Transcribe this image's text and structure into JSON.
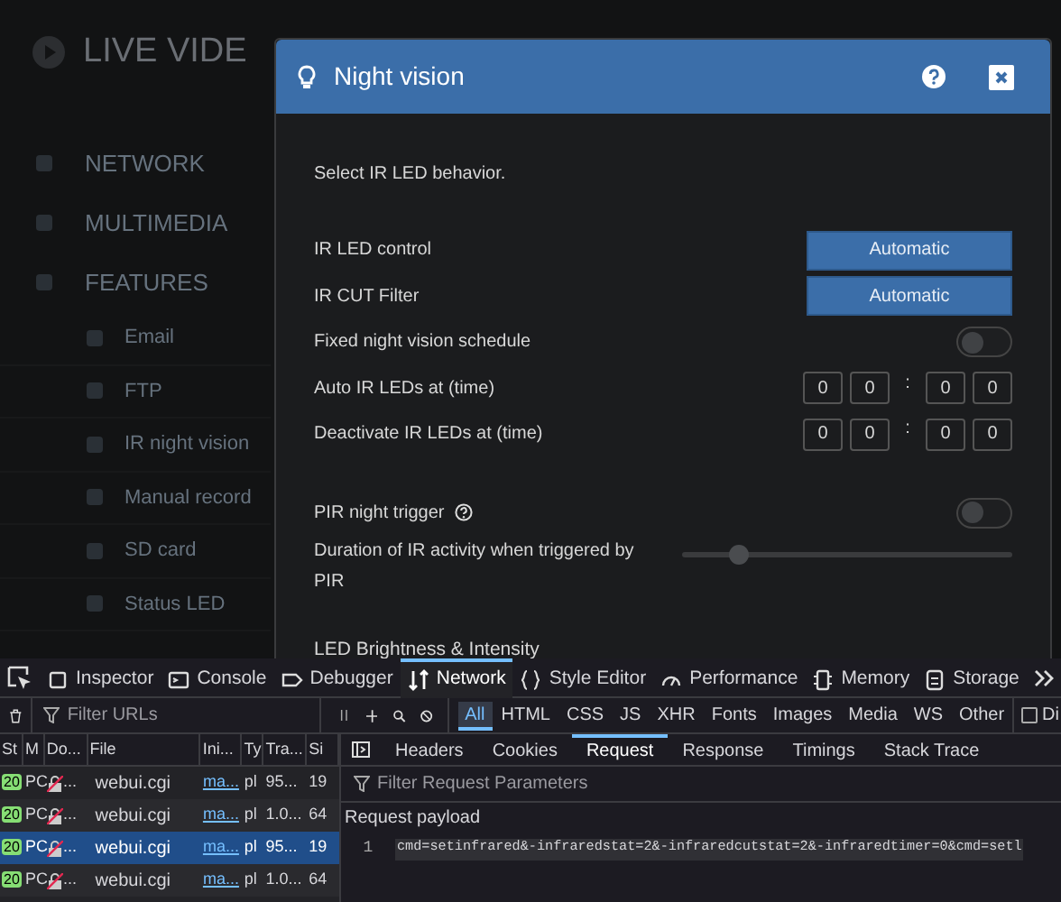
{
  "sidebar": {
    "logo": "LIVE VIDE",
    "items": [
      {
        "label": "NETWORK",
        "kind": "section"
      },
      {
        "label": "MULTIMEDIA",
        "kind": "section"
      },
      {
        "label": "FEATURES",
        "kind": "section"
      },
      {
        "label": "Email",
        "kind": "sub"
      },
      {
        "label": "FTP",
        "kind": "sub"
      },
      {
        "label": "IR night vision",
        "kind": "sub"
      },
      {
        "label": "Manual record",
        "kind": "sub"
      },
      {
        "label": "SD card",
        "kind": "sub"
      },
      {
        "label": "Status LED",
        "kind": "sub"
      }
    ]
  },
  "dialog": {
    "title": "Night vision",
    "intro": "Select IR LED behavior.",
    "groups": [
      [
        {
          "kind": "select",
          "label": "IR LED control",
          "value": "Automatic"
        },
        {
          "kind": "select",
          "label": "IR CUT Filter",
          "value": "Automatic"
        },
        {
          "kind": "toggle",
          "label": "Fixed night vision schedule",
          "on": false,
          "help": false
        },
        {
          "kind": "time",
          "label": "Auto IR LEDs at (time)",
          "digits": [
            "0",
            "0",
            "0",
            "0"
          ],
          "separator": ":"
        },
        {
          "kind": "time",
          "label": "Deactivate IR LEDs at (time)",
          "digits": [
            "0",
            "0",
            "0",
            "0"
          ],
          "separator": ":"
        }
      ],
      [
        {
          "kind": "toggle",
          "label": "PIR night trigger",
          "on": false,
          "help": true
        },
        {
          "kind": "slider",
          "label": "Duration of IR activity when triggered by PIR",
          "level": 0.17
        }
      ]
    ],
    "section_title": "LED Brightness & Intensity"
  },
  "devtools": {
    "tabs": [
      {
        "label": "Inspector",
        "selected": false
      },
      {
        "label": "Console",
        "selected": false
      },
      {
        "label": "Debugger",
        "selected": false
      },
      {
        "label": "Network",
        "selected": true
      },
      {
        "label": "Style Editor",
        "selected": false
      },
      {
        "label": "Performance",
        "selected": false
      },
      {
        "label": "Memory",
        "selected": false
      },
      {
        "label": "Storage",
        "selected": false
      }
    ],
    "filter": {
      "placeholder": "Filter URLs"
    },
    "type_filters": [
      {
        "label": "All",
        "selected": true
      },
      {
        "label": "HTML",
        "selected": false
      },
      {
        "label": "CSS",
        "selected": false
      },
      {
        "label": "JS",
        "selected": false
      },
      {
        "label": "XHR",
        "selected": false
      },
      {
        "label": "Fonts",
        "selected": false
      },
      {
        "label": "Images",
        "selected": false
      },
      {
        "label": "Media",
        "selected": false
      },
      {
        "label": "WS",
        "selected": false
      },
      {
        "label": "Other",
        "selected": false
      }
    ],
    "disable_cache": {
      "label": "Di",
      "checked": false
    },
    "table": {
      "columns": [
        "St",
        "M",
        "Do...",
        "File",
        "Ini...",
        "Ty",
        "Tra...",
        "Si"
      ],
      "rows": [
        {
          "status": "20",
          "method": "PC",
          "domain": "...",
          "file": "webui.cgi",
          "initiator": "ma...",
          "type": "pl",
          "transferred": "95...",
          "size": "19",
          "selected": false
        },
        {
          "status": "20",
          "method": "PC",
          "domain": "...",
          "file": "webui.cgi",
          "initiator": "ma...",
          "type": "pl",
          "transferred": "1.0...",
          "size": "64",
          "selected": false
        },
        {
          "status": "20",
          "method": "PC",
          "domain": "...",
          "file": "webui.cgi",
          "initiator": "ma...",
          "type": "pl",
          "transferred": "95...",
          "size": "19",
          "selected": true
        },
        {
          "status": "20",
          "method": "PC",
          "domain": "...",
          "file": "webui.cgi",
          "initiator": "ma...",
          "type": "pl",
          "transferred": "1.0...",
          "size": "64",
          "selected": false
        }
      ]
    },
    "detail": {
      "tabs": [
        {
          "label": "Headers",
          "selected": false
        },
        {
          "label": "Cookies",
          "selected": false
        },
        {
          "label": "Request",
          "selected": true
        },
        {
          "label": "Response",
          "selected": false
        },
        {
          "label": "Timings",
          "selected": false
        },
        {
          "label": "Stack Trace",
          "selected": false
        }
      ],
      "filter": {
        "placeholder": "Filter Request Parameters"
      },
      "section": "Request payload",
      "lines": [
        {
          "number": "1",
          "code": "cmd=setinfrared&-infraredstat=2&-infraredcutstat=2&-infraredtimer=0&cmd=setl"
        }
      ]
    }
  }
}
